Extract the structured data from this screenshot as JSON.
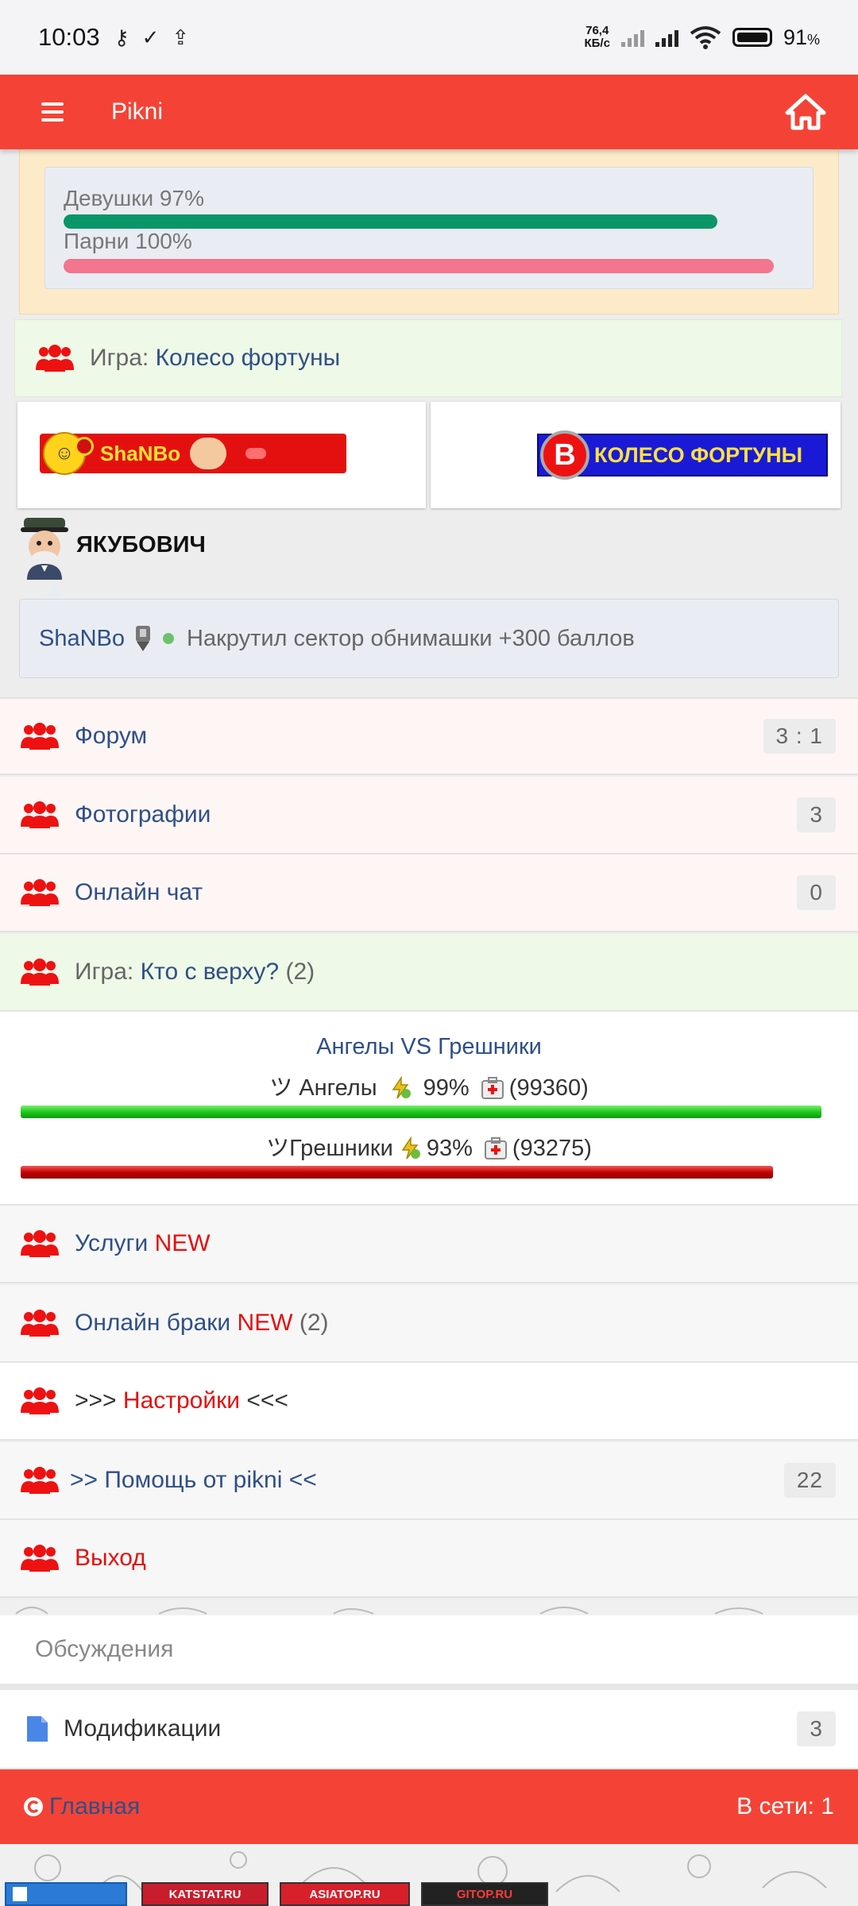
{
  "status_bar": {
    "time": "10:03",
    "net_speed_top": "76,4",
    "net_speed_bottom": "КБ/с",
    "battery": "91",
    "battery_unit": "%"
  },
  "app_bar": {
    "title": "Pikni"
  },
  "poll": {
    "girls_label": "Девушки 97%",
    "girls_value": 0.97,
    "girls_color": "#0a9668",
    "boys_label": "Парни 100%",
    "boys_value": 1.0,
    "boys_color": "#f3758e"
  },
  "game_wheel": {
    "prefix": "Игра:",
    "name": "Колесо фортуны"
  },
  "banners": {
    "left_text": "ShaNBo",
    "right_letter": "B",
    "right_text": "КОЛЕСО ФОРТУНЫ"
  },
  "host": {
    "name": "ЯКУБОВИЧ"
  },
  "message": {
    "user": "ShaNBo",
    "text": "Накрутил сектор обнимашки +300 баллов"
  },
  "menu": [
    {
      "label": "Форум",
      "badge": "3 : 1"
    },
    {
      "label": "Фотографии",
      "badge": "3"
    },
    {
      "label": "Онлайн чат",
      "badge": "0"
    }
  ],
  "game_top": {
    "prefix": "Игра:",
    "name": "Кто с верху?",
    "count": "(2)"
  },
  "battle": {
    "title": "Ангелы VS Грешники",
    "angels_name": "ツ Ангелы",
    "angels_pct": "99%",
    "angels_hp": "(99360)",
    "angels_value": 0.99,
    "sinners_name": "ツГрешники",
    "sinners_pct": "93%",
    "sinners_hp": "(93275)",
    "sinners_value": 0.93
  },
  "services": {
    "label": "Услуги",
    "new": "NEW"
  },
  "marriages": {
    "label": "Онлайн браки",
    "new": "NEW",
    "count": "(2)"
  },
  "settings": {
    "pre": ">>>",
    "label": "Настройки",
    "post": "<<<"
  },
  "help": {
    "label": ">> Помощь от pikni <<",
    "badge": "22"
  },
  "logout": {
    "label": "Выход"
  },
  "discussions": {
    "label": "Обсуждения"
  },
  "mods": {
    "label": "Модификации",
    "badge": "3"
  },
  "footer": {
    "home": "Главная",
    "online": "В сети: 1"
  },
  "counters": [
    "KATSTAT.RU",
    "ASIATOP.RU",
    "GITOP.RU"
  ]
}
